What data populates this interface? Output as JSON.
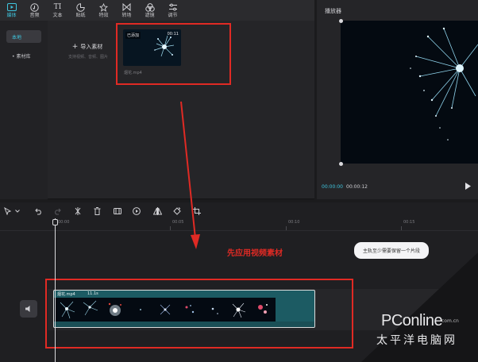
{
  "toolbar": {
    "tabs": [
      {
        "label": "媒体",
        "icon": "media-icon"
      },
      {
        "label": "音频",
        "icon": "audio-icon"
      },
      {
        "label": "文本",
        "icon": "text-icon"
      },
      {
        "label": "贴纸",
        "icon": "sticker-icon"
      },
      {
        "label": "特效",
        "icon": "effects-icon"
      },
      {
        "label": "转场",
        "icon": "transition-icon"
      },
      {
        "label": "滤镜",
        "icon": "filter-icon"
      },
      {
        "label": "调节",
        "icon": "adjust-icon"
      }
    ],
    "text_glyph": "TI"
  },
  "sidebar": {
    "items": [
      {
        "label": "本地"
      },
      {
        "label": "• 素材库"
      }
    ]
  },
  "media": {
    "import_label": "导入素材",
    "import_hint": "支持视频、音频、图片",
    "clip": {
      "badge": "已添加",
      "duration": "00:11",
      "name": "烟花.mp4"
    }
  },
  "player": {
    "title": "播放器",
    "current_time": "00:00:00",
    "total_time": "00:00:12"
  },
  "timeline": {
    "ticks": [
      "00:00",
      "00:05",
      "00:10",
      "00:15"
    ],
    "tooltip": "主轨至少需要保留一个片段",
    "annotation": "先应用视频素材",
    "clip": {
      "name": "烟花.mp4",
      "duration": "11.1s"
    }
  },
  "watermark": {
    "logo": "PConline",
    "sub": "太平洋电脑网",
    "url": "com.cn"
  },
  "colors": {
    "accent": "#3fc5de",
    "annotation": "#e02a24",
    "clip_track": "#1c5b63"
  }
}
